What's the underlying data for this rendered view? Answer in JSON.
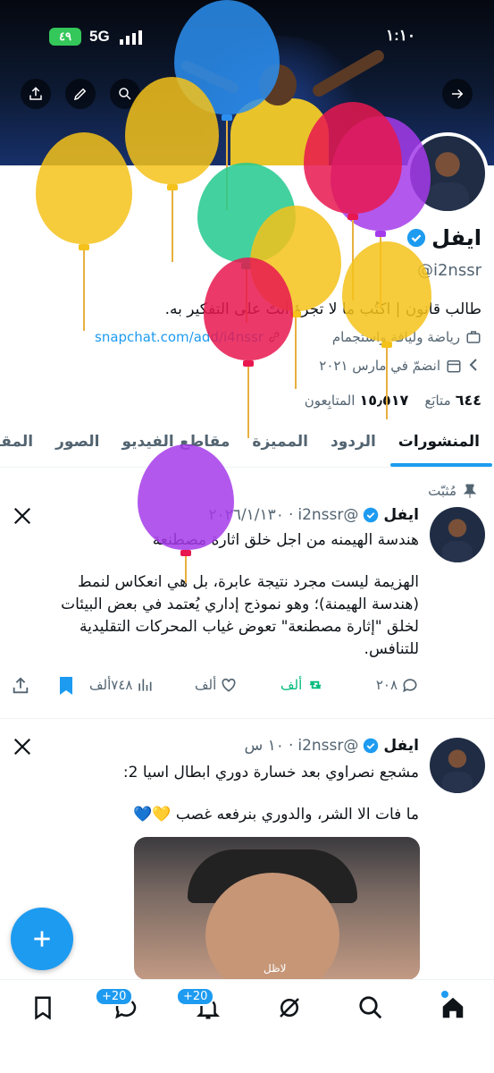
{
  "status_bar": {
    "time": "١:١٠",
    "network": "5G",
    "battery": "٤٩"
  },
  "profile": {
    "name": "ايفل",
    "handle": "@i2nssr",
    "bio": "طالب قانون | اكتُب ما لا تجرؤ أنتَ على التفكير به.",
    "category": "رياضة ولياقة واستجمام",
    "link": "snapchat.com/add/i4nssr",
    "joined": "انضمّ في مارس ٢٠٢١",
    "following_count": "٦٤٤",
    "following_label": "متابَع",
    "followers_count": "١٥٫٥١٧",
    "followers_label": "المتابِعون"
  },
  "tabs": [
    "المنشورات",
    "الردود",
    "المميزة",
    "مقاطع الفيديو",
    "الصور",
    "المقالا"
  ],
  "pinned_label": "مُثبّت",
  "tweets": [
    {
      "name": "ايفل",
      "handle": "@i2nssr",
      "time": "٢٠٢٦/١/١٣٠",
      "line1": "هندسة الهيمنه من اجل خلق اثارة مصطنعة",
      "line2": "الهزيمة ليست مجرد نتيجة عابرة، بل هي انعكاس لنمط",
      "line3": "(هندسة الهيمنة)؛ وهو نموذج إداري يُعتمد في بعض البيئات",
      "line4": "لخلق \"إثارة مصطنعة\" تعوض غياب المحركات التقليدية",
      "line5": "للتنافس.",
      "replies": "٢٠٨",
      "retweets": "ألف",
      "likes": "ألف",
      "views": "٧٤٨ألف"
    },
    {
      "name": "ايفل",
      "handle": "@i2nssr",
      "time": "١٠ س",
      "line1": "مشجع نصراوي بعد خسارة دوري ابطال اسيا 2:",
      "line2": "ما فات الا الشر، والدوري بنرفعه غصب 💛💙",
      "media_caption": "لاظل"
    }
  ],
  "nav_badges": {
    "messages": "+20",
    "notifications": "+20"
  },
  "colors": {
    "accent": "#1d9bf0",
    "verified": "#1d9bf0",
    "retweet_active": "#00ba7c"
  },
  "balloon_colors": [
    "#2b8ff0",
    "#f4c21a",
    "#e8174f",
    "#a53bea",
    "#22c98e"
  ]
}
